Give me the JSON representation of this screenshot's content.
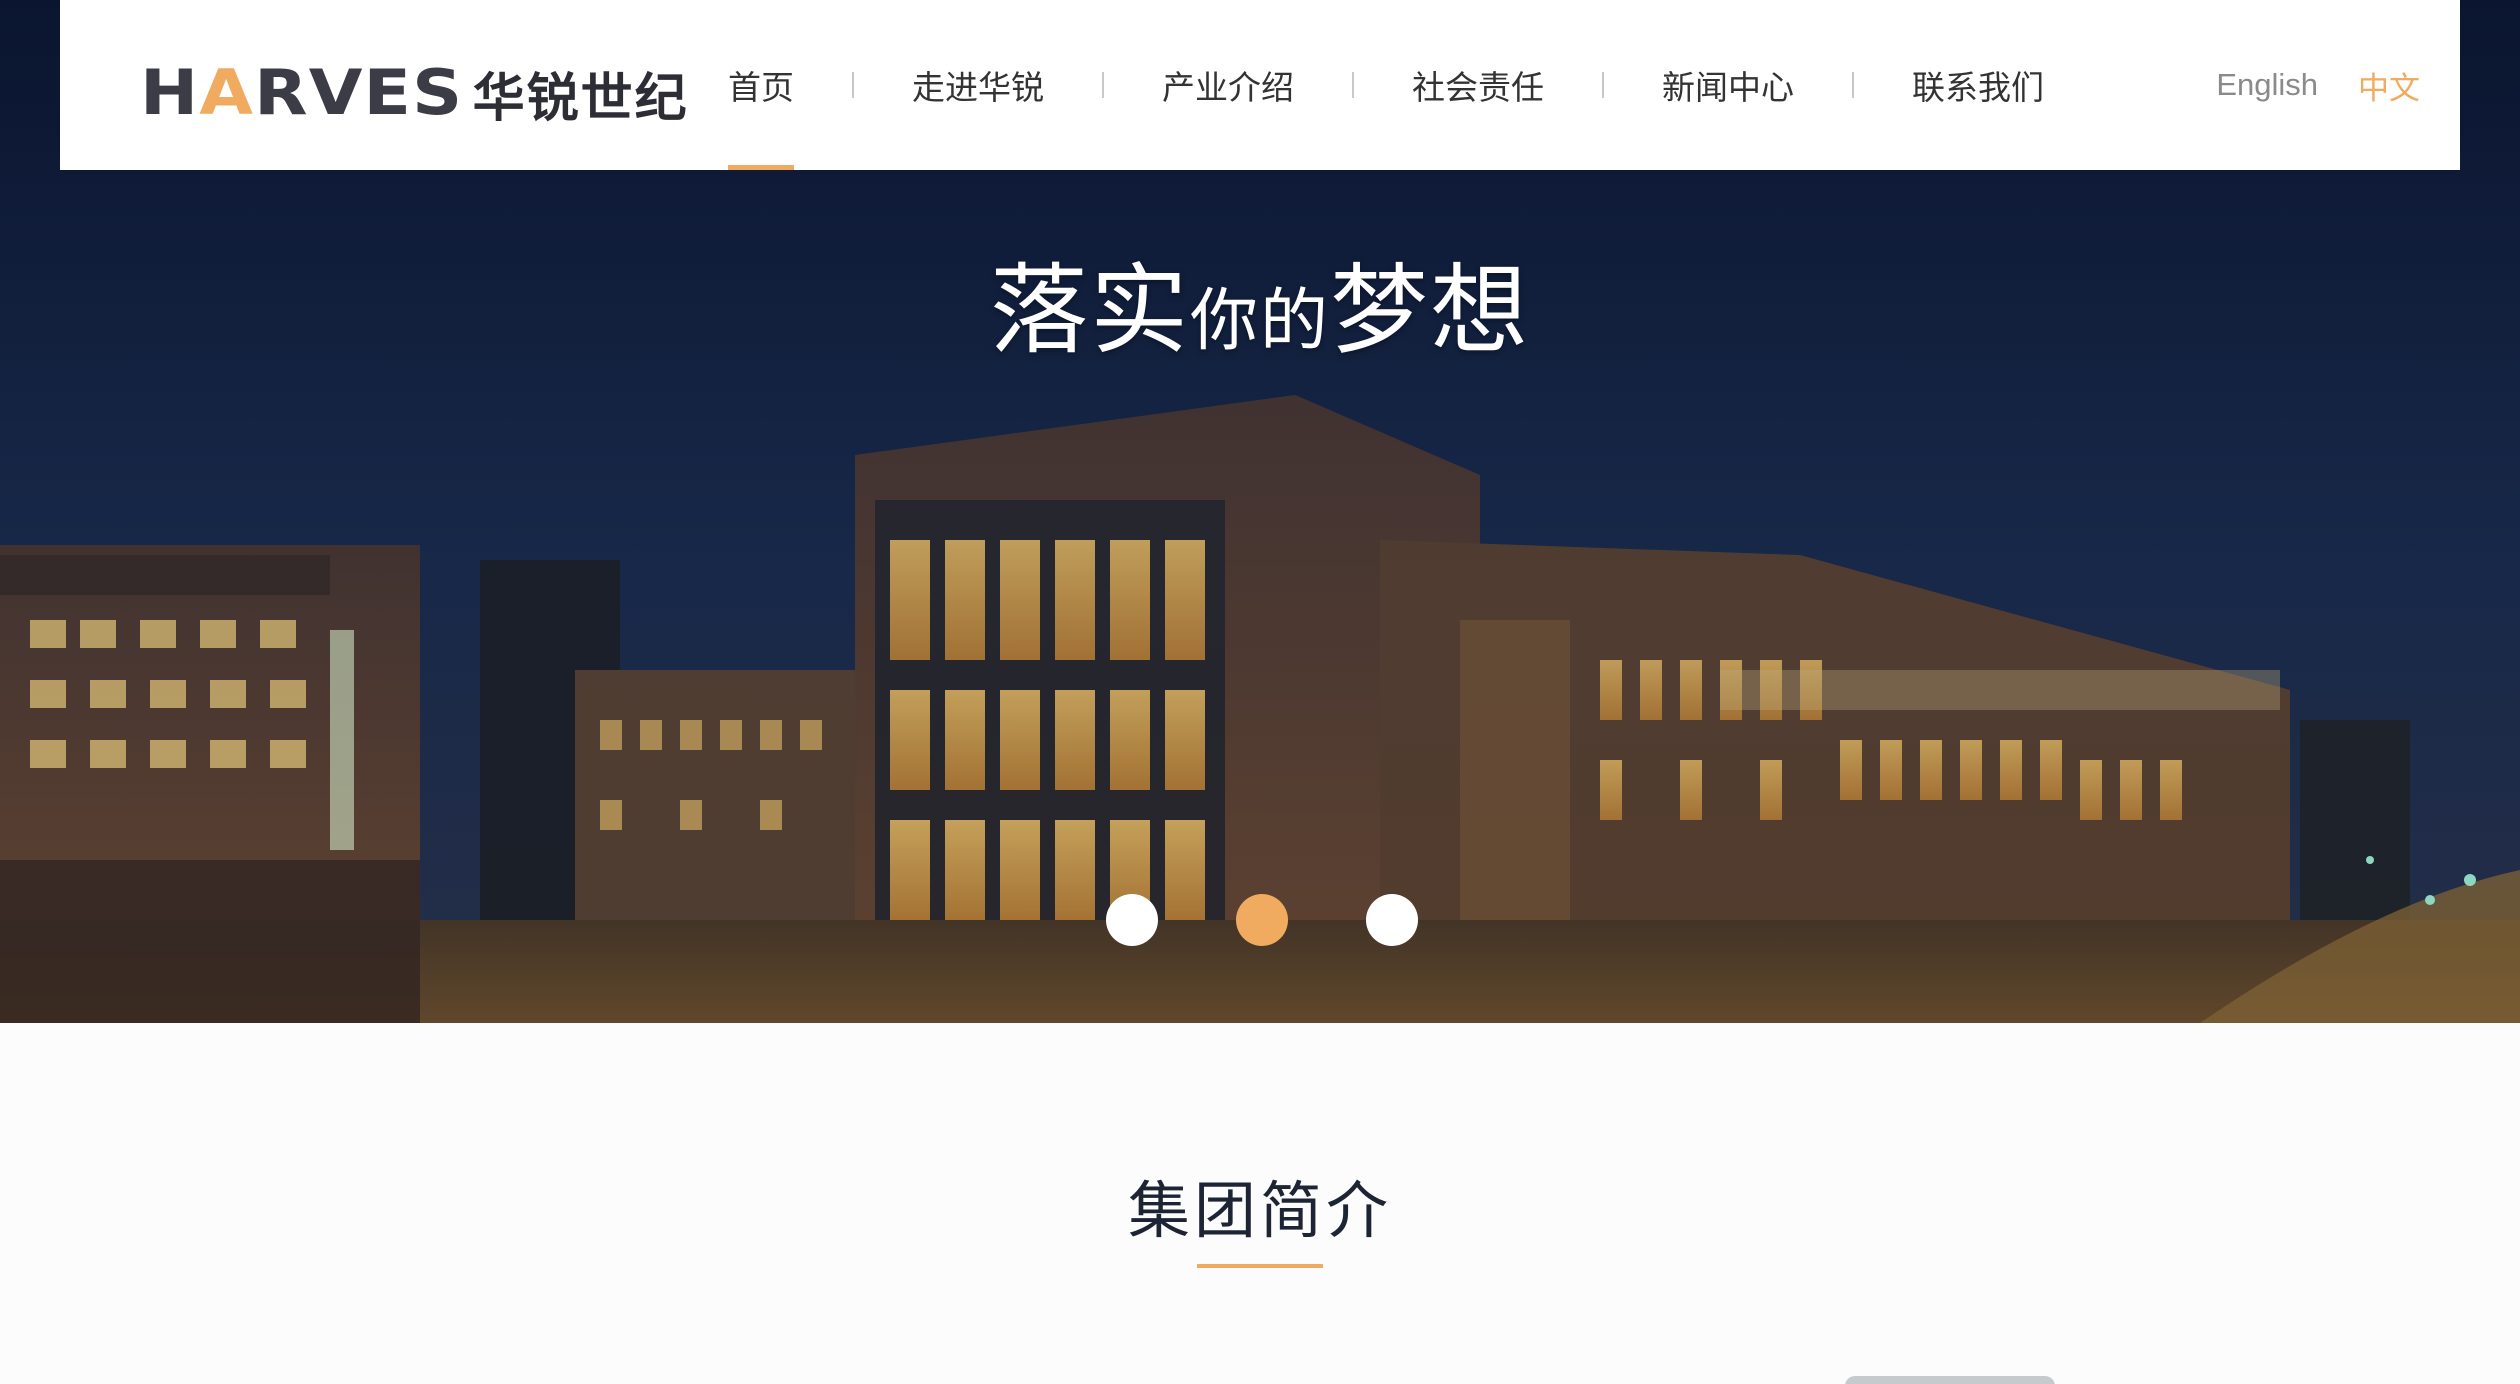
{
  "header": {
    "logo_latin_a": "H",
    "logo_latin_b": "A",
    "logo_latin_c": "RVES",
    "logo_cn": "华锐世纪",
    "nav": [
      {
        "label": "首页",
        "active": true
      },
      {
        "label": "走进华锐",
        "active": false
      },
      {
        "label": "产业介绍",
        "active": false
      },
      {
        "label": "社会责任",
        "active": false
      },
      {
        "label": "新闻中心",
        "active": false
      },
      {
        "label": "联系我们",
        "active": false
      }
    ],
    "lang_en": "English",
    "lang_cn": "中文"
  },
  "hero": {
    "slogan_part1": "落实",
    "slogan_part2": "你的",
    "slogan_part3": "梦想",
    "slides_total": 3,
    "active_slide": 2
  },
  "section": {
    "title": "集团简介"
  },
  "colors": {
    "accent": "#f1ab61",
    "nav_text": "#333333",
    "title_text": "#1d2433"
  }
}
